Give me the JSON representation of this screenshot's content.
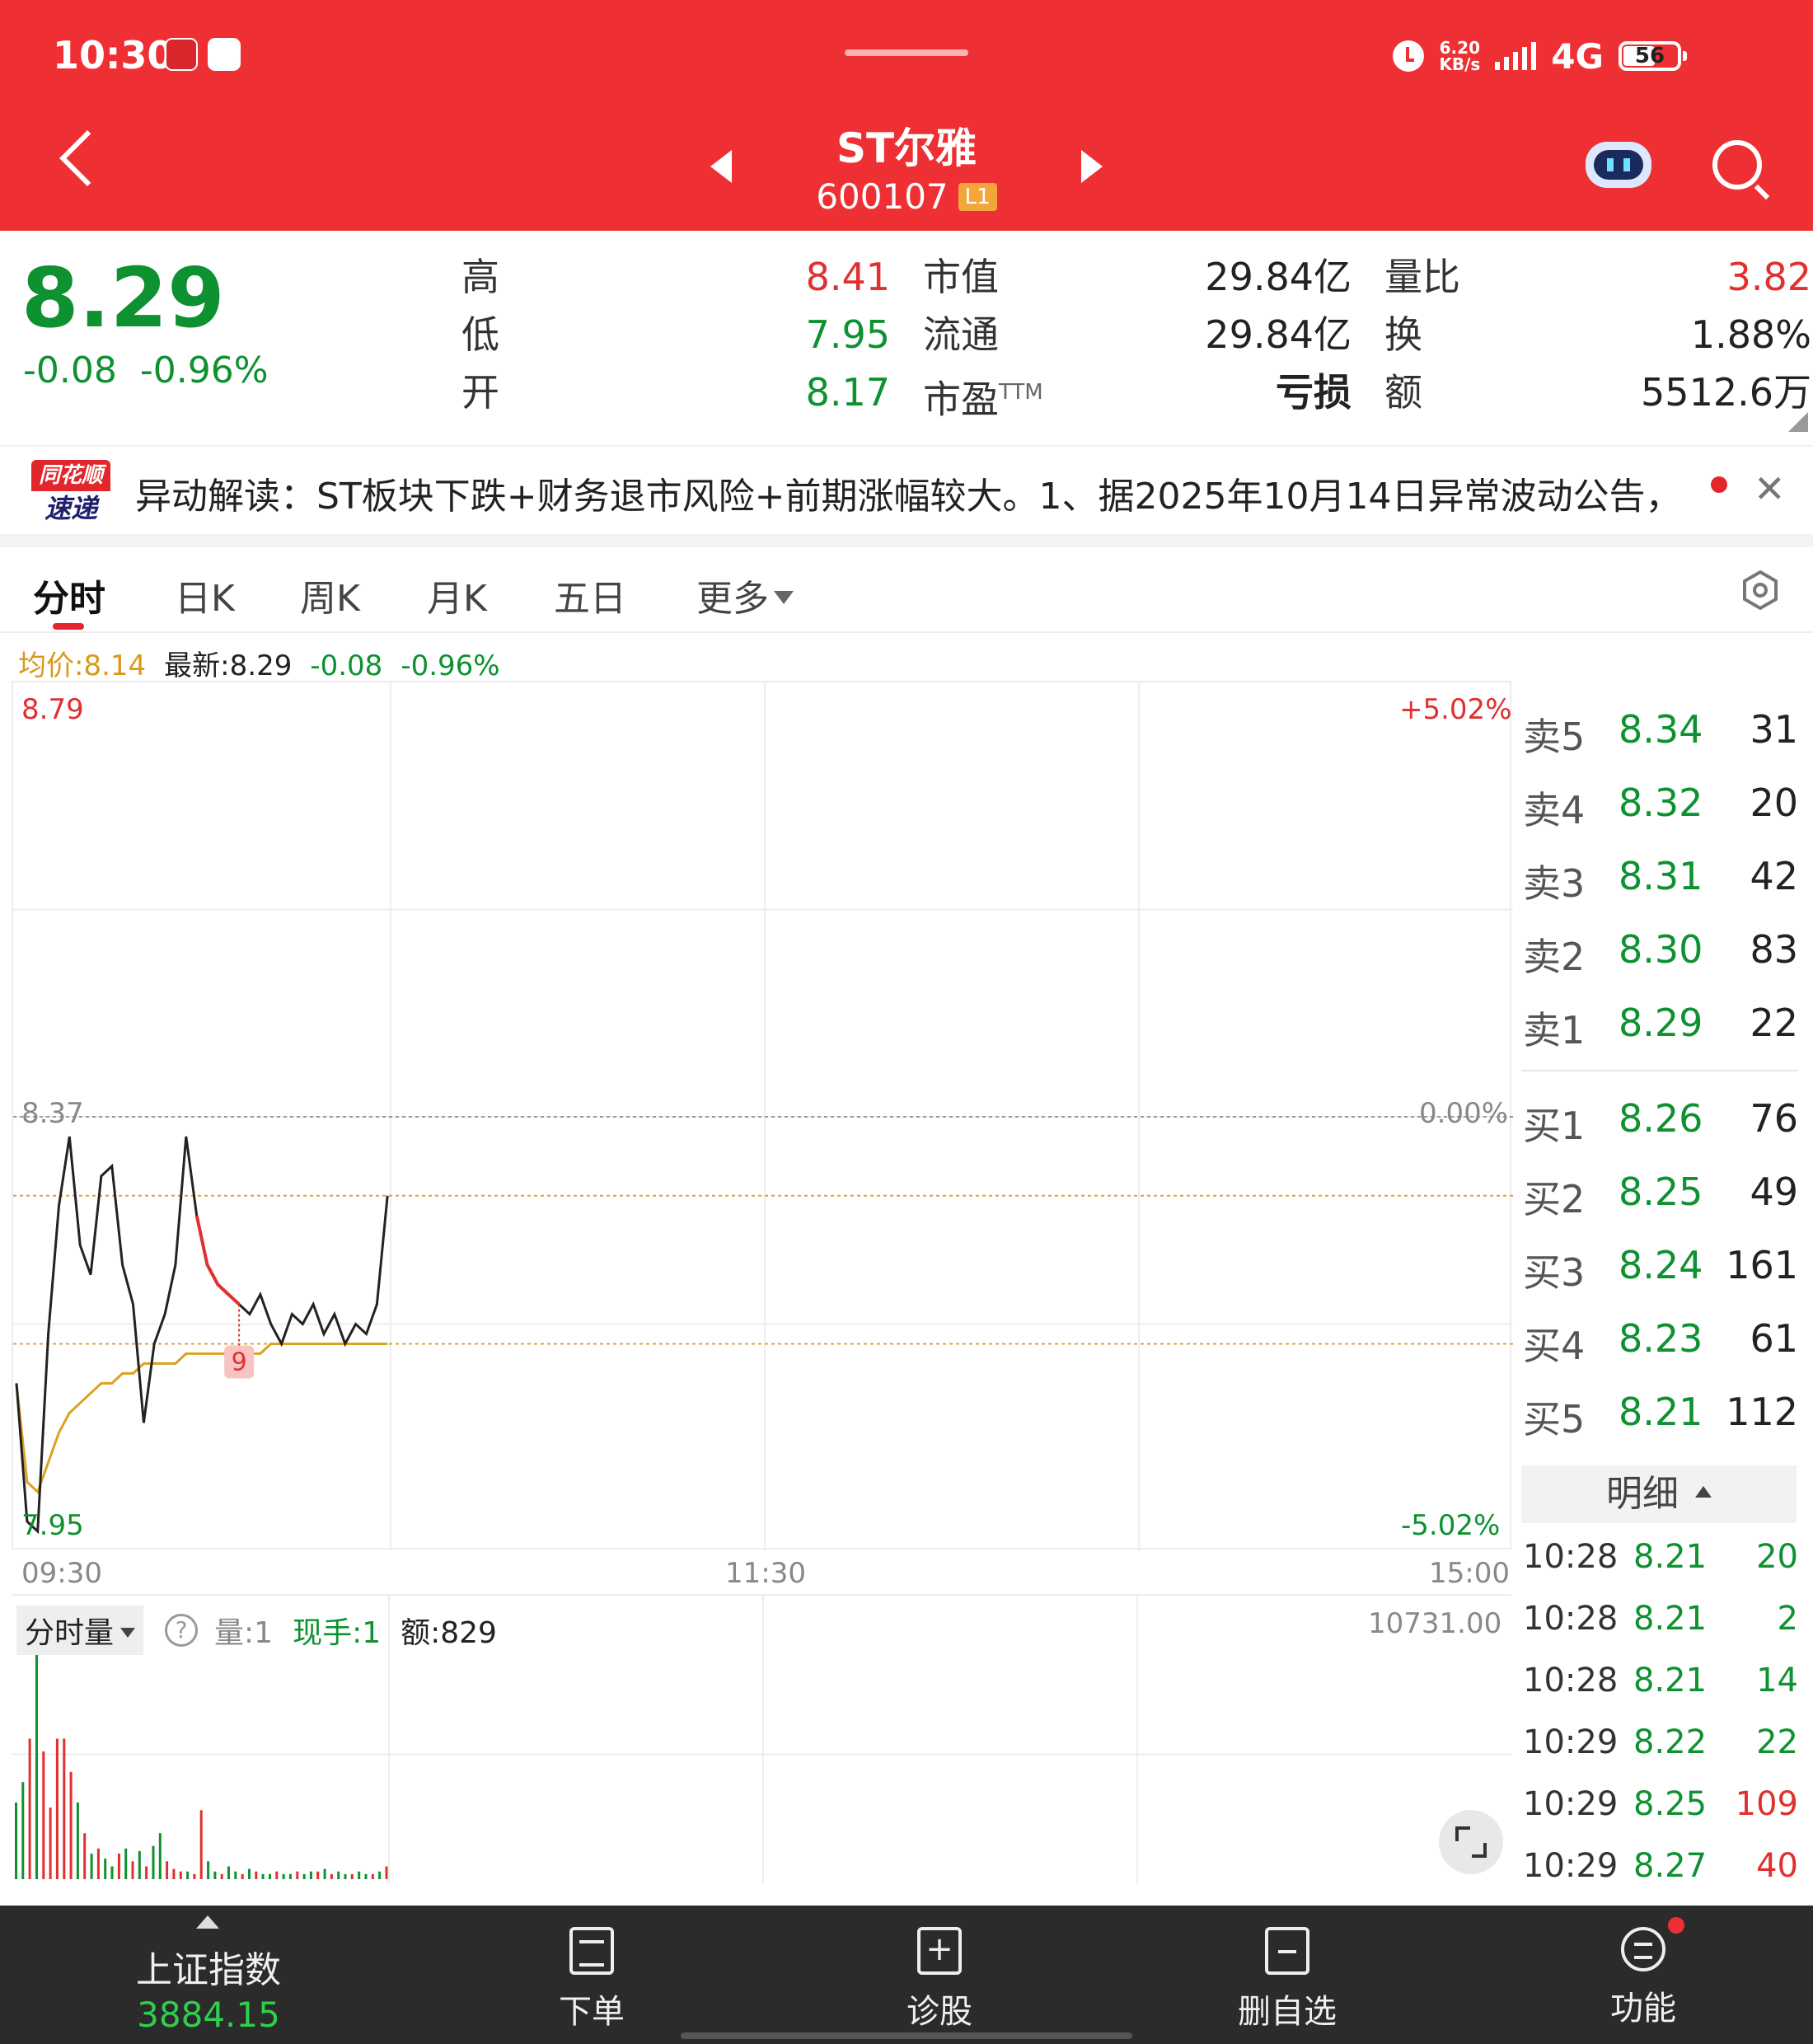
{
  "status_bar": {
    "time": "10:30",
    "net_speed_value": "6.20",
    "net_speed_unit": "KB/s",
    "network": "4G",
    "battery": "56"
  },
  "header": {
    "stock_name": "ST尔雅",
    "stock_code": "600107",
    "level_badge": "L1",
    "icons": [
      "back-icon",
      "prev-stock-icon",
      "next-stock-icon",
      "robot-assistant-icon",
      "search-icon"
    ]
  },
  "quote": {
    "price": "8.29",
    "change": "-0.08",
    "change_pct": "-0.96%",
    "high_label": "高",
    "high": "8.41",
    "low_label": "低",
    "low": "7.95",
    "open_label": "开",
    "open": "8.17",
    "mktcap_label": "市值",
    "mktcap": "29.84亿",
    "float_label": "流通",
    "float": "29.84亿",
    "pe_label": "市盈",
    "pe_sup": "TTM",
    "pe": "亏损",
    "volratio_label": "量比",
    "volratio": "3.82",
    "turnover_label": "换",
    "turnover": "1.88%",
    "amount_label": "额",
    "amount": "5512.6万"
  },
  "news": {
    "logo_top": "同花顺",
    "logo_bottom": "速递",
    "text": "异动解读：ST板块下跌+财务退市风险+前期涨幅较大。1、据2025年10月14日异常波动公告，…"
  },
  "tabs": [
    {
      "label": "分时",
      "active": true
    },
    {
      "label": "日K"
    },
    {
      "label": "周K"
    },
    {
      "label": "月K"
    },
    {
      "label": "五日"
    },
    {
      "label": "更多"
    }
  ],
  "info": {
    "avg": "均价:8.14",
    "latest": "最新:8.29",
    "change": "-0.08",
    "change_pct": "-0.96%"
  },
  "chart_data": {
    "type": "line",
    "title": "",
    "series": [
      {
        "values": [
          8.1,
          7.96,
          7.95,
          8.15,
          8.28,
          8.35,
          8.24,
          8.21,
          8.31,
          8.32,
          8.22,
          8.18,
          8.06,
          8.14,
          8.17,
          8.22,
          8.35,
          8.27,
          8.22,
          8.2,
          8.19,
          8.18,
          8.17,
          8.19,
          8.16,
          8.14,
          8.17,
          8.16,
          8.18,
          8.15,
          8.17,
          8.14,
          8.16,
          8.15,
          8.18,
          8.29
        ]
      },
      {
        "values": [
          8.1,
          8.0,
          7.99,
          8.02,
          8.05,
          8.07,
          8.08,
          8.09,
          8.1,
          8.1,
          8.11,
          8.11,
          8.12,
          8.12,
          8.12,
          8.12,
          8.13,
          8.13,
          8.13,
          8.13,
          8.13,
          8.13,
          8.13,
          8.13,
          8.14,
          8.14,
          8.14,
          8.14,
          8.14,
          8.14,
          8.14,
          8.14,
          8.14,
          8.14,
          8.14,
          8.14
        ]
      }
    ],
    "ylim": [
      7.95,
      8.79
    ],
    "prev_close": 8.37,
    "y_top_label": "8.79",
    "y_bottom_label": "7.95",
    "y_mid_label": "8.37",
    "pct_top": "+5.02%",
    "pct_mid": "0.00%",
    "pct_bottom": "-5.02%",
    "x_labels": [
      "09:30",
      "11:30",
      "15:00"
    ],
    "marker_label": "9"
  },
  "volume": {
    "type_label": "分时量",
    "help_icon": "?",
    "qty": "量:1",
    "current": "现手:1",
    "amount": "额:829",
    "max_label": "10731.00",
    "bars": [
      0.3,
      0.38,
      0.55,
      1.0,
      0.5,
      0.28,
      0.55,
      0.55,
      0.42,
      0.3,
      0.18,
      0.1,
      0.12,
      0.08,
      0.05,
      0.1,
      0.12,
      0.07,
      0.11,
      0.05,
      0.13,
      0.18,
      0.07,
      0.04,
      0.03,
      0.03,
      0.02,
      0.27,
      0.07,
      0.03,
      0.02,
      0.05,
      0.03,
      0.02,
      0.04,
      0.03,
      0.02,
      0.02,
      0.03,
      0.02,
      0.02,
      0.03,
      0.02,
      0.03,
      0.03,
      0.04,
      0.02,
      0.03,
      0.02,
      0.02,
      0.03,
      0.02,
      0.02,
      0.03,
      0.05
    ],
    "bar_dirs": [
      "g",
      "g",
      "r",
      "g",
      "r",
      "r",
      "r",
      "r",
      "r",
      "g",
      "r",
      "g",
      "r",
      "g",
      "g",
      "r",
      "g",
      "r",
      "g",
      "r",
      "g",
      "g",
      "r",
      "r",
      "r",
      "g",
      "r",
      "r",
      "g",
      "g",
      "r",
      "g",
      "g",
      "r",
      "g",
      "r",
      "g",
      "g",
      "r",
      "g",
      "g",
      "r",
      "g",
      "g",
      "r",
      "g",
      "r",
      "g",
      "g",
      "r",
      "g",
      "g",
      "r",
      "g",
      "r"
    ]
  },
  "order_book": {
    "asks": [
      {
        "label": "卖5",
        "price": "8.34",
        "vol": "31"
      },
      {
        "label": "卖4",
        "price": "8.32",
        "vol": "20"
      },
      {
        "label": "卖3",
        "price": "8.31",
        "vol": "42"
      },
      {
        "label": "卖2",
        "price": "8.30",
        "vol": "83"
      },
      {
        "label": "卖1",
        "price": "8.29",
        "vol": "22"
      }
    ],
    "bids": [
      {
        "label": "买1",
        "price": "8.26",
        "vol": "76"
      },
      {
        "label": "买2",
        "price": "8.25",
        "vol": "49"
      },
      {
        "label": "买3",
        "price": "8.24",
        "vol": "161"
      },
      {
        "label": "买4",
        "price": "8.23",
        "vol": "61"
      },
      {
        "label": "买5",
        "price": "8.21",
        "vol": "112"
      }
    ]
  },
  "trade_detail": {
    "header": "明细",
    "rows": [
      {
        "time": "10:28",
        "price": "8.21",
        "vol": "20",
        "dir": "green"
      },
      {
        "time": "10:28",
        "price": "8.21",
        "vol": "2",
        "dir": "green"
      },
      {
        "time": "10:28",
        "price": "8.21",
        "vol": "14",
        "dir": "green"
      },
      {
        "time": "10:29",
        "price": "8.22",
        "vol": "22",
        "dir": "green"
      },
      {
        "time": "10:29",
        "price": "8.25",
        "vol": "109",
        "dir": "red"
      },
      {
        "time": "10:29",
        "price": "8.27",
        "vol": "40",
        "dir": "red"
      }
    ]
  },
  "bottom_nav": {
    "index_name": "上证指数",
    "index_value": "3884.15",
    "items": [
      "下单",
      "诊股",
      "删自选",
      "功能"
    ]
  }
}
